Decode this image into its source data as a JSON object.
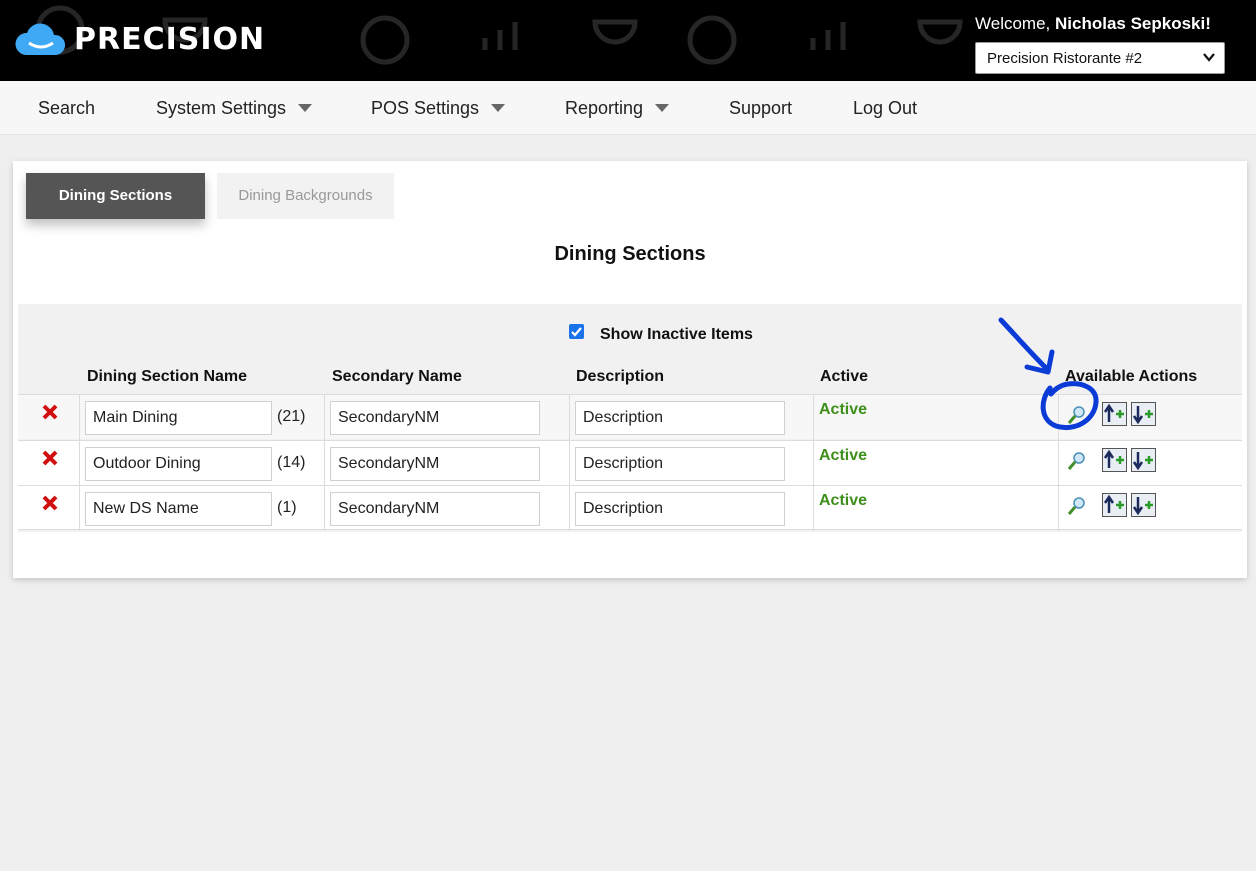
{
  "header": {
    "logo_text": "PRECISION",
    "welcome_prefix": "Welcome, ",
    "user_name": "Nicholas Sepkoski!",
    "store_selected": "Precision Ristorante #2"
  },
  "nav": {
    "items": [
      {
        "label": "Search"
      },
      {
        "label": "System Settings"
      },
      {
        "label": "POS Settings"
      },
      {
        "label": "Reporting"
      },
      {
        "label": "Support"
      },
      {
        "label": "Log Out"
      }
    ]
  },
  "tabs": {
    "active": "Dining Sections",
    "inactive": "Dining Backgrounds"
  },
  "page_title": "Dining Sections",
  "show_inactive_label": "Show Inactive Items",
  "table": {
    "headers": {
      "name": "Dining Section Name",
      "secondary": "Secondary Name",
      "description": "Description",
      "active": "Active",
      "actions": "Available Actions"
    },
    "rows": [
      {
        "name": "Main Dining",
        "count": "(21)",
        "secondary": "SecondaryNM",
        "description": "Description",
        "active": "Active"
      },
      {
        "name": "Outdoor Dining",
        "count": "(14)",
        "secondary": "SecondaryNM",
        "description": "Description",
        "active": "Active"
      },
      {
        "name": "New DS Name",
        "count": "(1)",
        "secondary": "SecondaryNM",
        "description": "Description",
        "active": "Active"
      }
    ]
  },
  "colors": {
    "active_green": "#3d8f1a",
    "annotation_blue": "#0a3bd6",
    "delete_red": "#d01010"
  }
}
